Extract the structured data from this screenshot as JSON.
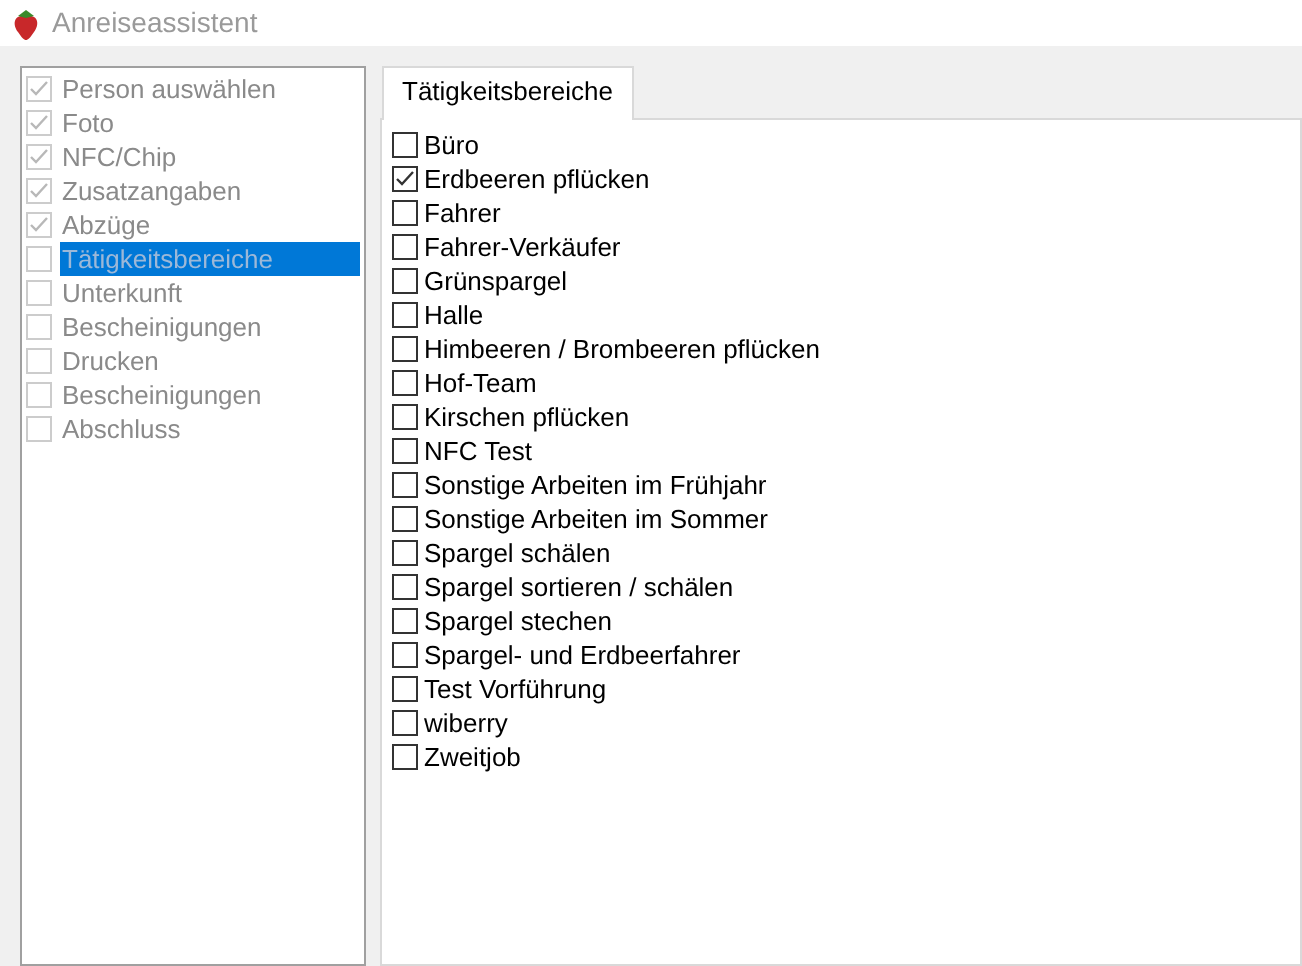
{
  "window": {
    "title": "Anreiseassistent"
  },
  "steps": [
    {
      "label": "Person auswählen",
      "checked": true,
      "selected": false,
      "disabled": true
    },
    {
      "label": "Foto",
      "checked": true,
      "selected": false,
      "disabled": true
    },
    {
      "label": "NFC/Chip",
      "checked": true,
      "selected": false,
      "disabled": true
    },
    {
      "label": "Zusatzangaben",
      "checked": true,
      "selected": false,
      "disabled": true
    },
    {
      "label": "Abzüge",
      "checked": true,
      "selected": false,
      "disabled": true
    },
    {
      "label": "Tätigkeitsbereiche",
      "checked": false,
      "selected": true,
      "disabled": true
    },
    {
      "label": "Unterkunft",
      "checked": false,
      "selected": false,
      "disabled": true
    },
    {
      "label": "Bescheinigungen",
      "checked": false,
      "selected": false,
      "disabled": true
    },
    {
      "label": "Drucken",
      "checked": false,
      "selected": false,
      "disabled": true
    },
    {
      "label": "Bescheinigungen",
      "checked": false,
      "selected": false,
      "disabled": true
    },
    {
      "label": "Abschluss",
      "checked": false,
      "selected": false,
      "disabled": true
    }
  ],
  "tabs": [
    {
      "label": "Tätigkeitsbereiche",
      "selected": true
    }
  ],
  "activities": [
    {
      "label": "Büro",
      "checked": false
    },
    {
      "label": "Erdbeeren pflücken",
      "checked": true
    },
    {
      "label": "Fahrer",
      "checked": false
    },
    {
      "label": "Fahrer-Verkäufer",
      "checked": false
    },
    {
      "label": "Grünspargel",
      "checked": false
    },
    {
      "label": "Halle",
      "checked": false
    },
    {
      "label": "Himbeeren / Brombeeren pflücken",
      "checked": false
    },
    {
      "label": "Hof-Team",
      "checked": false
    },
    {
      "label": "Kirschen pflücken",
      "checked": false
    },
    {
      "label": "NFC Test",
      "checked": false
    },
    {
      "label": "Sonstige Arbeiten im Frühjahr",
      "checked": false
    },
    {
      "label": "Sonstige Arbeiten im Sommer",
      "checked": false
    },
    {
      "label": "Spargel schälen",
      "checked": false
    },
    {
      "label": "Spargel sortieren / schälen",
      "checked": false
    },
    {
      "label": "Spargel stechen",
      "checked": false
    },
    {
      "label": "Spargel- und Erdbeerfahrer",
      "checked": false
    },
    {
      "label": "Test Vorführung",
      "checked": false
    },
    {
      "label": "wiberry",
      "checked": false
    },
    {
      "label": "Zweitjob",
      "checked": false
    }
  ]
}
